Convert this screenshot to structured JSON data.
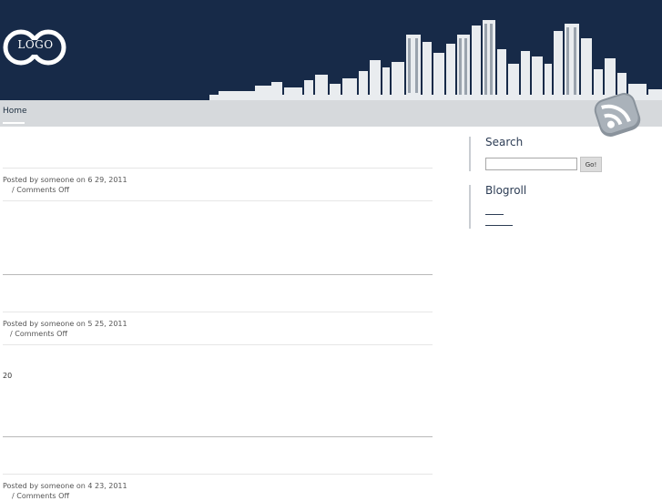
{
  "header": {
    "logo_text": "LOGO"
  },
  "nav": {
    "items": [
      {
        "label": "Home"
      }
    ]
  },
  "posts": [
    {
      "meta": "Posted by someone on 6   29, 2011",
      "comments": "/ Comments Off",
      "body": ""
    },
    {
      "meta": "Posted by someone on 5   25, 2011",
      "comments": "/ Comments Off",
      "body": "20"
    },
    {
      "meta": "Posted by someone on 4   23, 2011",
      "comments": "/ Comments Off",
      "body": ""
    }
  ],
  "sidebar": {
    "search": {
      "title": "Search",
      "value": "",
      "button_label": "Go!"
    },
    "blogroll": {
      "title": "Blogroll"
    }
  },
  "colors": {
    "header_bg": "#172a48",
    "nav_bg": "#d6d9dc",
    "accent": "#2d3d55"
  },
  "icons": {
    "logo": "logo-icon",
    "rss": "rss-icon"
  }
}
